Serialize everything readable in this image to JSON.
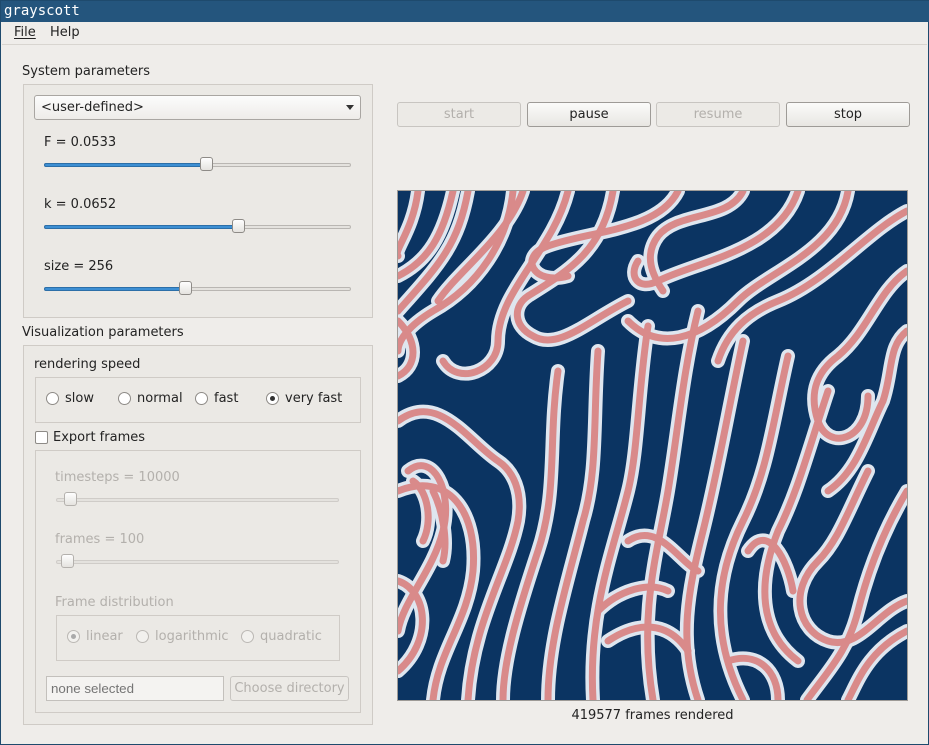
{
  "window": {
    "title": "grayscott"
  },
  "menu": {
    "file": "File",
    "help": "Help"
  },
  "system": {
    "title": "System parameters",
    "preset": "<user-defined>",
    "F": {
      "label": "F = 0.0533",
      "fraction": 0.53
    },
    "k": {
      "label": "k = 0.0652",
      "fraction": 0.64
    },
    "size": {
      "label": "size = 256",
      "fraction": 0.46
    }
  },
  "visualization": {
    "title": "Visualization parameters",
    "speed_title": "rendering speed",
    "speeds": [
      "slow",
      "normal",
      "fast",
      "very fast"
    ],
    "selected_speed": "very fast",
    "export_label": "Export frames",
    "export_checked": false,
    "timesteps": {
      "label": "timesteps = 10000",
      "fraction": 0.03
    },
    "frames": {
      "label": "frames = 100",
      "fraction": 0.02
    },
    "distribution_title": "Frame distribution",
    "distributions": [
      "linear",
      "logarithmic",
      "quadratic"
    ],
    "selected_distribution": "linear",
    "directory_placeholder": "none selected",
    "choose_directory": "Choose directory"
  },
  "controls": {
    "start": "start",
    "pause": "pause",
    "resume": "resume",
    "stop": "stop"
  },
  "status": "419577 frames rendered",
  "colors": {
    "background": "#0b3462",
    "stripe": "#d98a8a",
    "halo": "#dfe6ef"
  }
}
